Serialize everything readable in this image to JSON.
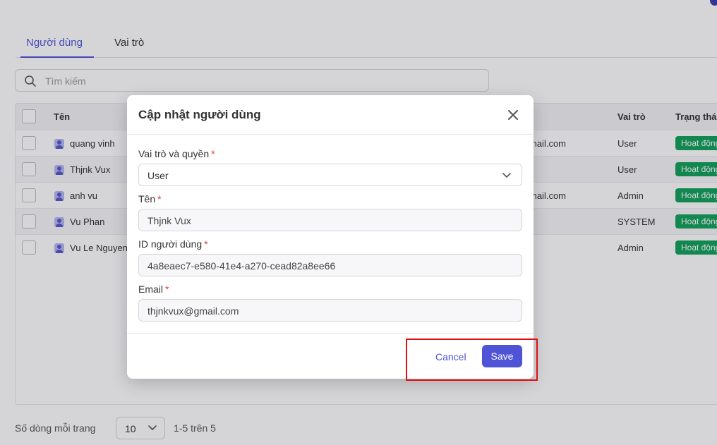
{
  "tabs": [
    {
      "label": "Người dùng",
      "active": true
    },
    {
      "label": "Vai trò",
      "active": false
    }
  ],
  "search": {
    "placeholder": "Tìm kiếm",
    "value": ""
  },
  "table": {
    "headers": {
      "name": "Tên",
      "role": "Vai trò",
      "status": "Trạng thái"
    },
    "rows": [
      {
        "name": "quang vinh",
        "email": "mail.com",
        "role": "User",
        "status": "Hoạt động"
      },
      {
        "name": "Thjnk Vux",
        "email": "",
        "role": "User",
        "status": "Hoạt động"
      },
      {
        "name": "anh vu",
        "email": "mail.com",
        "role": "Admin",
        "status": "Hoạt động"
      },
      {
        "name": "Vu Phan",
        "email": "",
        "role": "SYSTEM",
        "status": "Hoạt động"
      },
      {
        "name": "Vu Le Nguyen",
        "email": "",
        "role": "Admin",
        "status": "Hoạt động"
      }
    ]
  },
  "pagination": {
    "rows_per_page_label": "Số dòng mỗi trang",
    "page_size": "10",
    "range": "1-5 trên 5"
  },
  "modal": {
    "title": "Cập nhật người dùng",
    "fields": {
      "role": {
        "label": "Vai trò và quyền",
        "value": "User"
      },
      "name": {
        "label": "Tên",
        "value": "Thjnk Vux"
      },
      "user_id": {
        "label": "ID người dùng",
        "value": "4a8eaec7-e580-41e4-a270-cead82a8ee66"
      },
      "email": {
        "label": "Email",
        "value": "thjnkvux@gmail.com"
      }
    },
    "required_mark": "*",
    "cancel_label": "Cancel",
    "save_label": "Save"
  },
  "colors": {
    "accent": "#4f53d6",
    "status_active": "#12a15a",
    "required": "#e03c3c",
    "highlight": "#e01010"
  }
}
